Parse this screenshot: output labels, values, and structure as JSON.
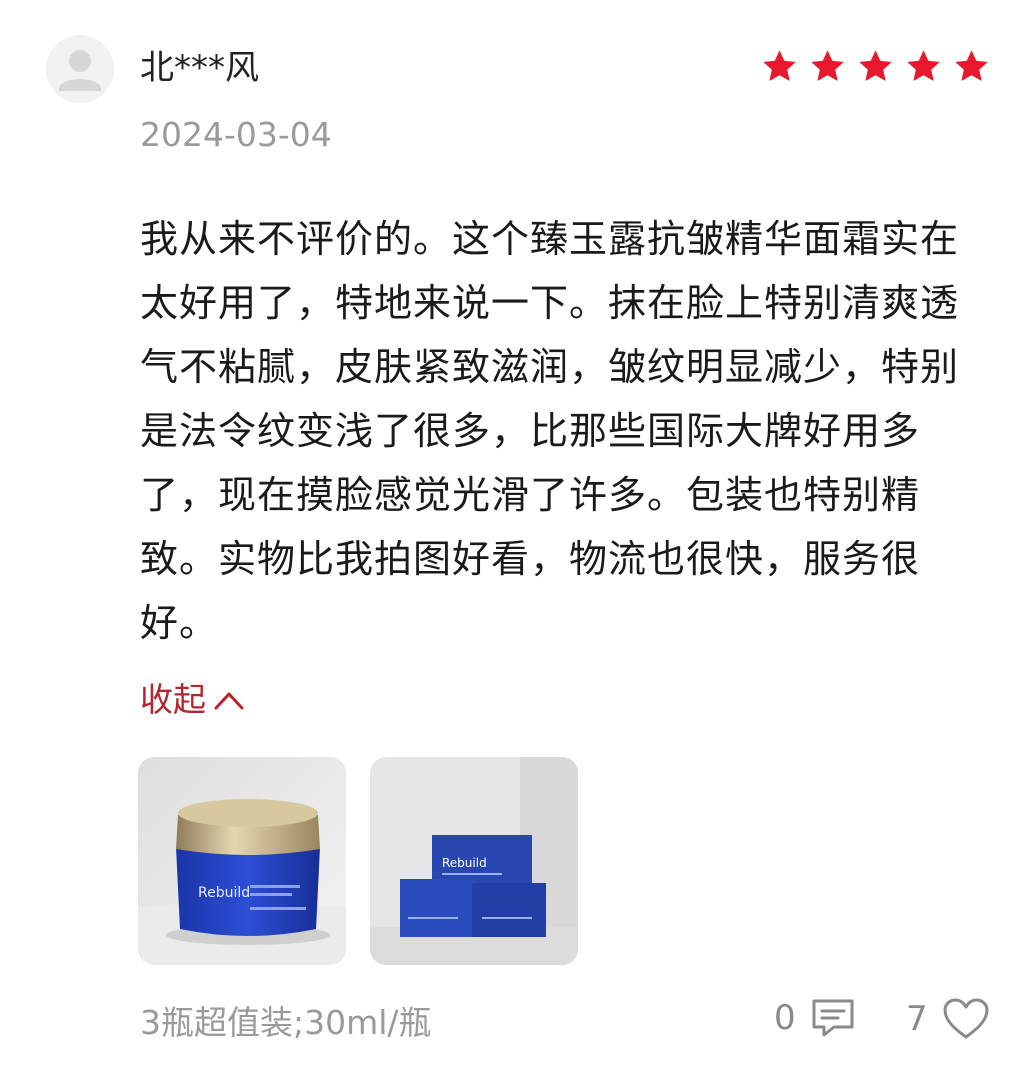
{
  "review": {
    "username": "北***风",
    "rating": 5,
    "date": "2024-03-04",
    "text": "我从来不评价的。这个臻玉露抗皱精华面霜实在太好用了，特地来说一下。抹在脸上特别清爽透气不粘腻，皮肤紧致滋润，皱纹明显减少，特别是法令纹变浅了很多，比那些国际大牌好用多了，现在摸脸感觉光滑了许多。包装也特别精致。实物比我拍图好看，物流也很快，服务很好。",
    "collapse_label": "收起",
    "spec": "3瓶超值装;30ml/瓶",
    "comment_count": "0",
    "like_count": "7"
  },
  "photos": [
    {
      "brand": "Rebuild",
      "icon": "cream-jar-photo"
    },
    {
      "brand": "Rebuild",
      "icon": "product-boxes-photo"
    }
  ],
  "colors": {
    "star": "#e8192c",
    "accent": "#b3262d",
    "muted": "#9a9a9a",
    "jar_blue": "#1f3fb8"
  }
}
